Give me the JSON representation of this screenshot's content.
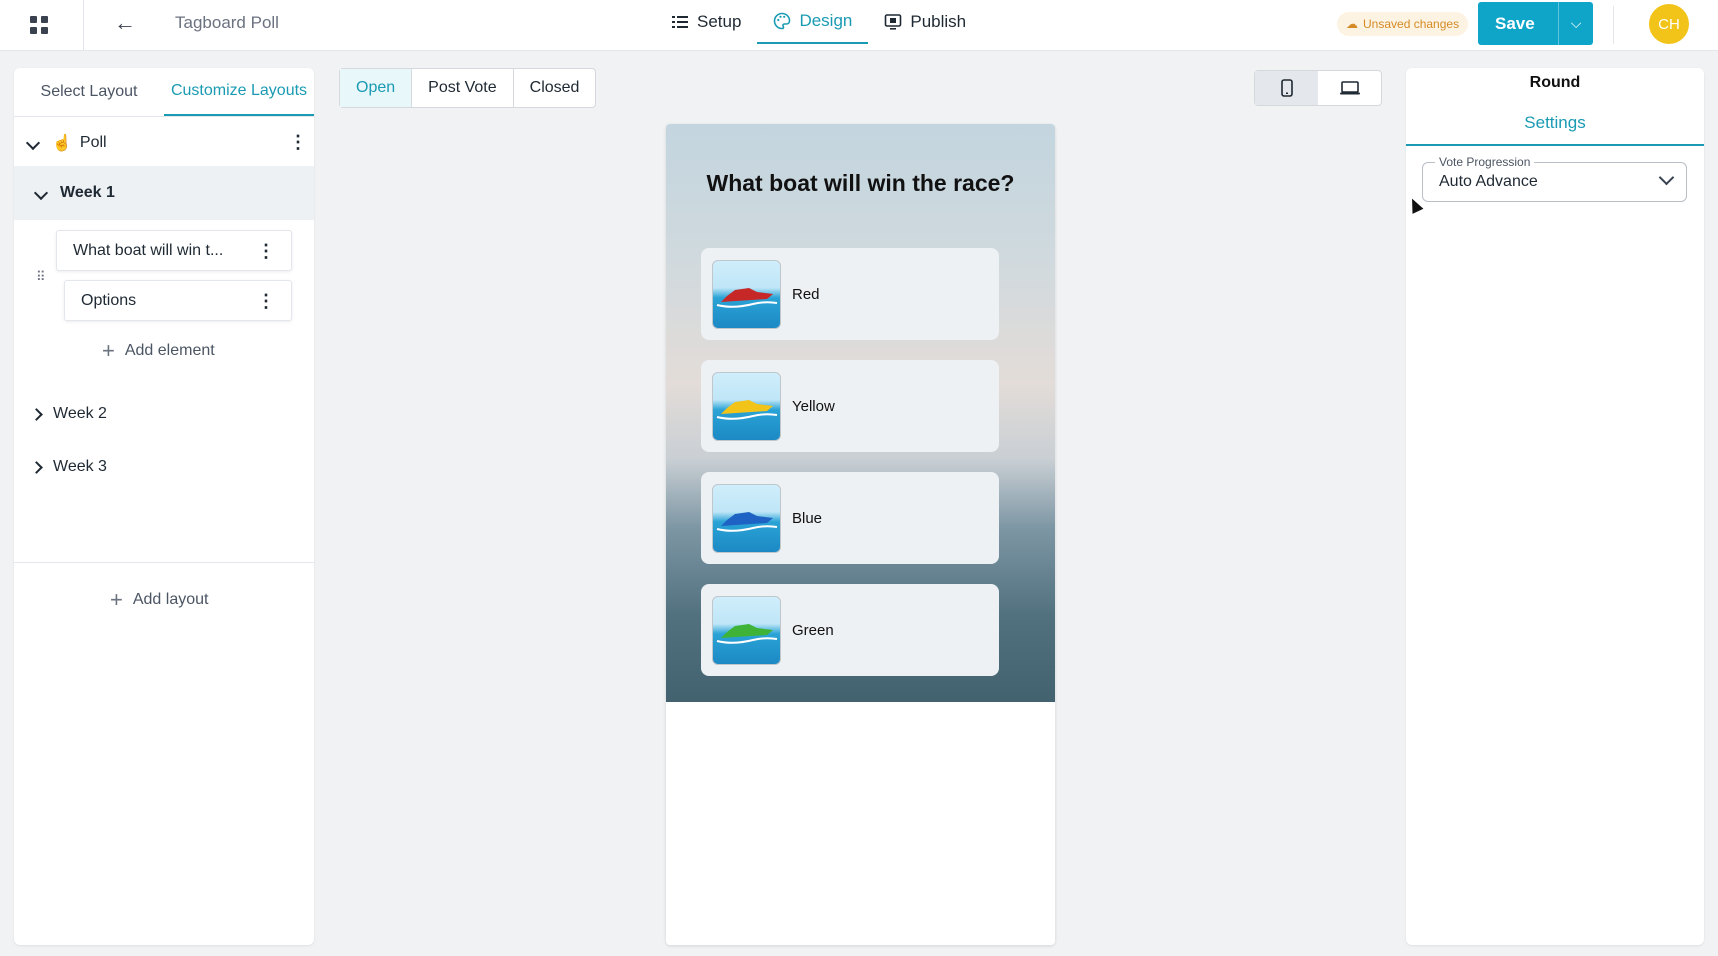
{
  "topbar": {
    "title": "Tagboard Poll",
    "tabs": [
      {
        "label": "Setup",
        "icon": "list-icon"
      },
      {
        "label": "Design",
        "icon": "palette-icon"
      },
      {
        "label": "Publish",
        "icon": "monitor-icon"
      }
    ],
    "active_tab": "Design",
    "unsaved_label": "Unsaved changes",
    "save_label": "Save",
    "avatar_initials": "CH"
  },
  "left_panel": {
    "tabs": [
      "Select Layout",
      "Customize Layouts"
    ],
    "active_tab": "Customize Layouts",
    "root": "Poll",
    "week1": "Week 1",
    "elements": [
      "What boat will win t...",
      "Options"
    ],
    "add_element": "Add element",
    "week2": "Week 2",
    "week3": "Week 3",
    "add_layout": "Add layout"
  },
  "state_tabs": [
    "Open",
    "Post Vote",
    "Closed"
  ],
  "active_state": "Open",
  "preview": {
    "question": "What boat will win the race?",
    "options": [
      {
        "label": "Red",
        "boat_color": "#c62828"
      },
      {
        "label": "Yellow",
        "boat_color": "#f2c318"
      },
      {
        "label": "Blue",
        "boat_color": "#1e63c4"
      },
      {
        "label": "Green",
        "boat_color": "#3fb337"
      }
    ]
  },
  "right_panel": {
    "title": "Round",
    "tab": "Settings",
    "field_label": "Vote Progression",
    "field_value": "Auto Advance"
  },
  "colors": {
    "accent": "#1a9bb3",
    "save": "#0ea5c9",
    "unsaved_bg": "#fdf3e3",
    "unsaved_text": "#d48b25",
    "avatar": "#f2c318"
  }
}
